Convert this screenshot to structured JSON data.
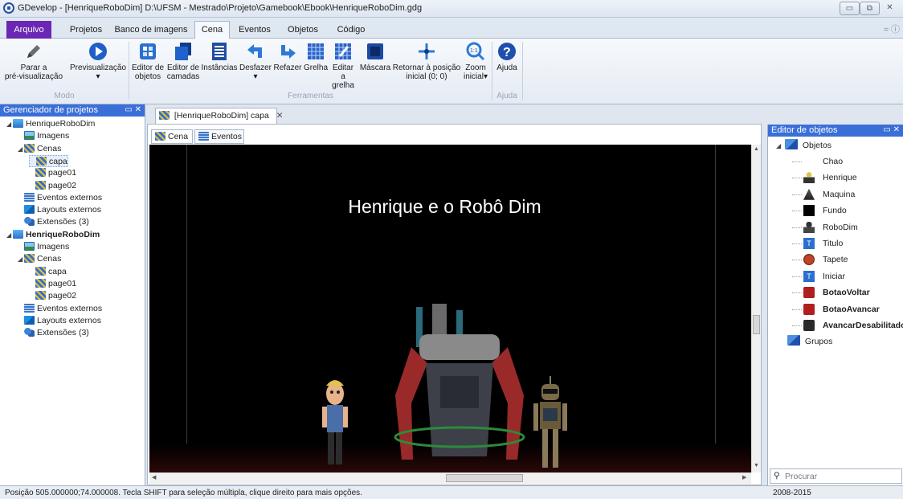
{
  "window": {
    "title": "GDevelop - [HenriqueRoboDim] D:\\UFSM - Mestrado\\Projeto\\Gamebook\\Ebook\\HenriqueRoboDim.gdg",
    "controls": [
      "minimize",
      "restore",
      "close"
    ]
  },
  "menu": {
    "tabs": [
      "Arquivo",
      "Projetos",
      "Banco de imagens",
      "Cena",
      "Eventos",
      "Objetos",
      "Código"
    ],
    "active": "Cena"
  },
  "ribbon": {
    "buttons": [
      {
        "line1": "Parar a",
        "line2": "pré-visualização",
        "icon": "pencil-icon"
      },
      {
        "line1": "Previsualização",
        "line2": "▾",
        "icon": "play-icon"
      },
      {
        "line1": "Editor de",
        "line2": "objetos",
        "icon": "objects-editor-icon"
      },
      {
        "line1": "Editor de",
        "line2": "camadas",
        "icon": "layers-icon"
      },
      {
        "line1": "Instâncias",
        "line2": "",
        "icon": "instances-icon"
      },
      {
        "line1": "Desfazer",
        "line2": "▾",
        "icon": "undo-icon"
      },
      {
        "line1": "Refazer",
        "line2": "",
        "icon": "redo-icon"
      },
      {
        "line1": "Grelha",
        "line2": "",
        "icon": "grid-icon"
      },
      {
        "line1": "Editar a",
        "line2": "grelha",
        "icon": "edit-grid-icon"
      },
      {
        "line1": "Máscara",
        "line2": "",
        "icon": "mask-icon"
      },
      {
        "line1": "Retornar à posição",
        "line2": "inicial (0; 0)",
        "icon": "origin-icon"
      },
      {
        "line1": "Zoom",
        "line2": "inicial▾",
        "icon": "zoom-icon"
      },
      {
        "line1": "Ajuda",
        "line2": "",
        "icon": "help-icon"
      }
    ],
    "groups": [
      "Modo",
      "Ferramentas",
      "Ajuda"
    ]
  },
  "project_manager": {
    "title": "Gerenciador de projetos",
    "tree": [
      {
        "label": "HenriqueRoboDim",
        "level": 0,
        "icon": "proj",
        "bold": false,
        "arrow": "◢"
      },
      {
        "label": "Imagens",
        "level": 1,
        "icon": "img"
      },
      {
        "label": "Cenas",
        "level": 1,
        "icon": "scene",
        "arrow": "◢"
      },
      {
        "label": "capa",
        "level": 2,
        "icon": "scene",
        "selected": true
      },
      {
        "label": "page01",
        "level": 2,
        "icon": "scene"
      },
      {
        "label": "page02",
        "level": 2,
        "icon": "scene"
      },
      {
        "label": "Eventos externos",
        "level": 1,
        "icon": "ev"
      },
      {
        "label": "Layouts externos",
        "level": 1,
        "icon": "layout"
      },
      {
        "label": "Extensões (3)",
        "level": 1,
        "icon": "ext"
      },
      {
        "label": "HenriqueRoboDim",
        "level": 0,
        "icon": "proj",
        "bold": true,
        "arrow": "◢"
      },
      {
        "label": "Imagens",
        "level": 1,
        "icon": "img"
      },
      {
        "label": "Cenas",
        "level": 1,
        "icon": "scene",
        "arrow": "◢"
      },
      {
        "label": "capa",
        "level": 2,
        "icon": "scene"
      },
      {
        "label": "page01",
        "level": 2,
        "icon": "scene"
      },
      {
        "label": "page02",
        "level": 2,
        "icon": "scene"
      },
      {
        "label": "Eventos externos",
        "level": 1,
        "icon": "ev"
      },
      {
        "label": "Layouts externos",
        "level": 1,
        "icon": "layout"
      },
      {
        "label": "Extensões (3)",
        "level": 1,
        "icon": "ext"
      }
    ]
  },
  "document": {
    "tab_label": "[HenriqueRoboDim] capa",
    "subtabs": [
      "Cena",
      "Eventos"
    ],
    "scene_title": "Henrique e o Robô Dim"
  },
  "object_editor": {
    "title": "Editor de objetos",
    "root": "Objetos",
    "objects": [
      {
        "name": "Chao",
        "bold": false,
        "icon": "none"
      },
      {
        "name": "Henrique",
        "bold": false,
        "icon": "boy"
      },
      {
        "name": "Maquina",
        "bold": false,
        "icon": "machine"
      },
      {
        "name": "Fundo",
        "bold": false,
        "icon": "black"
      },
      {
        "name": "RoboDim",
        "bold": false,
        "icon": "robot"
      },
      {
        "name": "Titulo",
        "bold": false,
        "icon": "text"
      },
      {
        "name": "Tapete",
        "bold": false,
        "icon": "rug"
      },
      {
        "name": "Iniciar",
        "bold": false,
        "icon": "text"
      },
      {
        "name": "BotaoVoltar",
        "bold": true,
        "icon": "back-button"
      },
      {
        "name": "BotaoAvancar",
        "bold": true,
        "icon": "next-button"
      },
      {
        "name": "AvancarDesabilitado",
        "bold": true,
        "icon": "disabled-button"
      }
    ],
    "groups_label": "Grupos",
    "search_placeholder": "Procurar"
  },
  "status": {
    "left": "Posição 505.000000;74.000008. Tecla SHIFT para seleção múltipla, clique direito para mais opções.",
    "right": "2008-2015"
  }
}
